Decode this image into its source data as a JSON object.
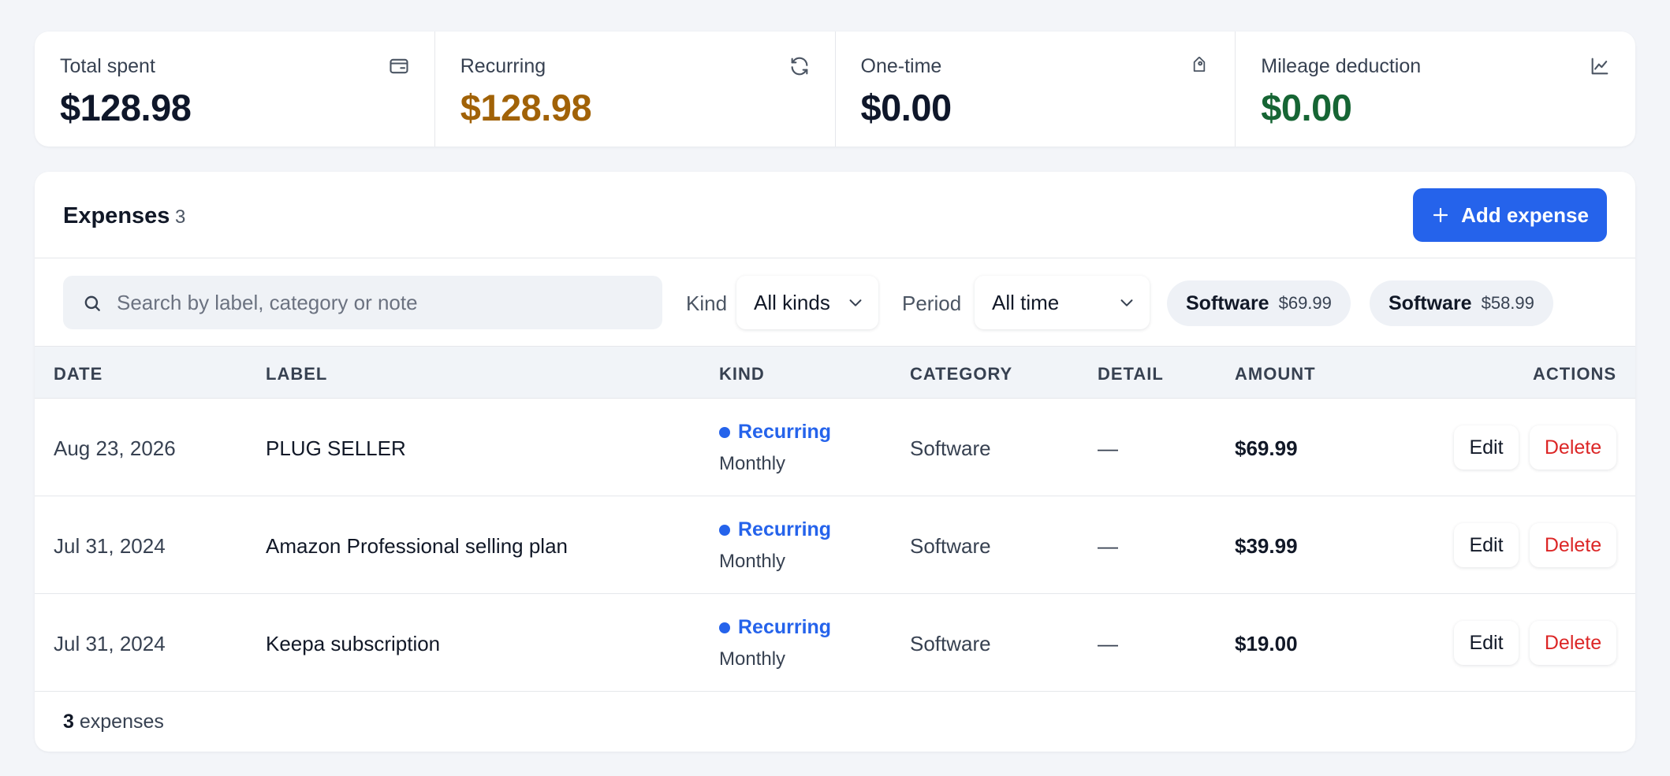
{
  "stats": [
    {
      "label": "Total spent",
      "value": "$128.98",
      "icon": "wallet-icon",
      "color": "#0f172a"
    },
    {
      "label": "Recurring",
      "value": "$128.98",
      "icon": "refresh-icon",
      "color": "#a16207"
    },
    {
      "label": "One-time",
      "value": "$0.00",
      "icon": "tag-icon",
      "color": "#0f172a"
    },
    {
      "label": "Mileage deduction",
      "value": "$0.00",
      "icon": "chart-line-icon",
      "color": "#166534"
    }
  ],
  "expenses": {
    "title": "Expenses",
    "count": "3",
    "add_label": "Add expense"
  },
  "filters": {
    "search_placeholder": "Search by label, category or note",
    "kind_label": "Kind",
    "kind_value": "All kinds",
    "period_label": "Period",
    "period_value": "All time",
    "chips": [
      {
        "name": "Software",
        "amount": "$69.99"
      },
      {
        "name": "Software",
        "amount": "$58.99"
      }
    ]
  },
  "table": {
    "headers": {
      "date": "DATE",
      "label": "LABEL",
      "kind": "KIND",
      "category": "CATEGORY",
      "detail": "DETAIL",
      "amount": "AMOUNT",
      "actions": "ACTIONS"
    },
    "rows": [
      {
        "date": "Aug 23, 2026",
        "label": "PLUG SELLER",
        "kind": "Recurring",
        "frequency": "Monthly",
        "category": "Software",
        "detail": "—",
        "amount": "$69.99",
        "edit": "Edit",
        "delete": "Delete"
      },
      {
        "date": "Jul 31, 2024",
        "label": "Amazon Professional selling plan",
        "kind": "Recurring",
        "frequency": "Monthly",
        "category": "Software",
        "detail": "—",
        "amount": "$39.99",
        "edit": "Edit",
        "delete": "Delete"
      },
      {
        "date": "Jul 31, 2024",
        "label": "Keepa subscription",
        "kind": "Recurring",
        "frequency": "Monthly",
        "category": "Software",
        "detail": "—",
        "amount": "$19.00",
        "edit": "Edit",
        "delete": "Delete"
      }
    ],
    "footer_count": "3",
    "footer_text": "expenses"
  },
  "colors": {
    "accent": "#2563eb",
    "danger": "#dc2626",
    "recurring_value": "#a16207",
    "mileage_value": "#166534"
  }
}
